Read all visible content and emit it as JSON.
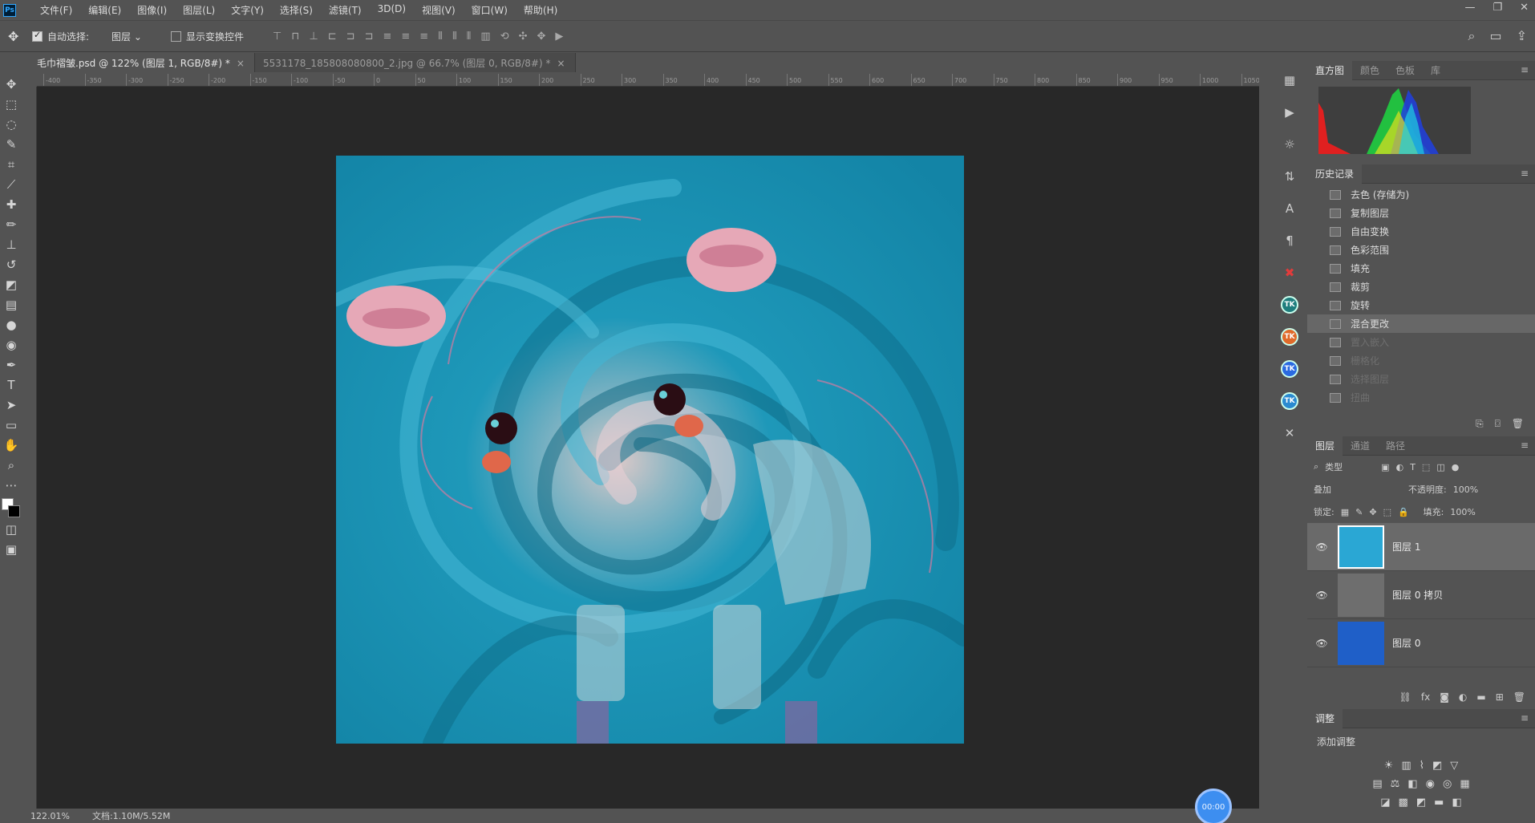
{
  "app": {
    "logo": "Ps"
  },
  "menu": [
    "文件(F)",
    "编辑(E)",
    "图像(I)",
    "图层(L)",
    "文字(Y)",
    "选择(S)",
    "滤镜(T)",
    "3D(D)",
    "视图(V)",
    "窗口(W)",
    "帮助(H)"
  ],
  "options": {
    "auto_select_label": "自动选择:",
    "auto_select_value": "图层",
    "show_transform_label": "显示变换控件"
  },
  "tabs": [
    {
      "label": "毛巾褶皱.psd @ 122% (图层 1, RGB/8#) *"
    },
    {
      "label": "5531178_185808080800_2.jpg @ 66.7% (图层 0, RGB/8#) *"
    }
  ],
  "ruler_ticks": [
    "-400",
    "-350",
    "-300",
    "-250",
    "-200",
    "-150",
    "-100",
    "-50",
    "0",
    "50",
    "100",
    "150",
    "200",
    "250",
    "300",
    "350",
    "400",
    "450",
    "500",
    "550",
    "600",
    "650",
    "700",
    "750",
    "800",
    "850",
    "900",
    "950",
    "1000",
    "1050"
  ],
  "status": {
    "zoom": "122.01%",
    "doc": "文档:1.10M/5.52M"
  },
  "panels": {
    "histogram_tabs": [
      "直方图",
      "颜色",
      "色板",
      "库"
    ],
    "history_title": "历史记录",
    "history_items": [
      {
        "label": "去色 (存储为)",
        "state": "normal"
      },
      {
        "label": "复制图层",
        "state": "normal"
      },
      {
        "label": "自由变换",
        "state": "normal"
      },
      {
        "label": "色彩范围",
        "state": "normal"
      },
      {
        "label": "填充",
        "state": "normal"
      },
      {
        "label": "裁剪",
        "state": "normal"
      },
      {
        "label": "旋转",
        "state": "normal"
      },
      {
        "label": "混合更改",
        "state": "selected"
      },
      {
        "label": "置入嵌入",
        "state": "dim"
      },
      {
        "label": "栅格化",
        "state": "dim"
      },
      {
        "label": "选择图层",
        "state": "dim"
      },
      {
        "label": "扭曲",
        "state": "dim"
      }
    ],
    "layers_tabs": [
      "图层",
      "通道",
      "路径"
    ],
    "layer_kind": "类型",
    "blend_mode": "叠加",
    "opacity_label": "不透明度:",
    "opacity_value": "100%",
    "lock_label": "锁定:",
    "fill_label": "填充:",
    "fill_value": "100%",
    "layers": [
      {
        "name": "图层 1",
        "selected": true,
        "thumb_color": "#2aa7d4"
      },
      {
        "name": "图层 0 拷贝",
        "selected": false,
        "thumb_color": "#6e6e6e"
      },
      {
        "name": "图层 0",
        "selected": false,
        "thumb_color": "#1f5fc8"
      }
    ],
    "adjust_title": "调整",
    "adjust_add": "添加调整"
  },
  "fab_label": "00:00"
}
